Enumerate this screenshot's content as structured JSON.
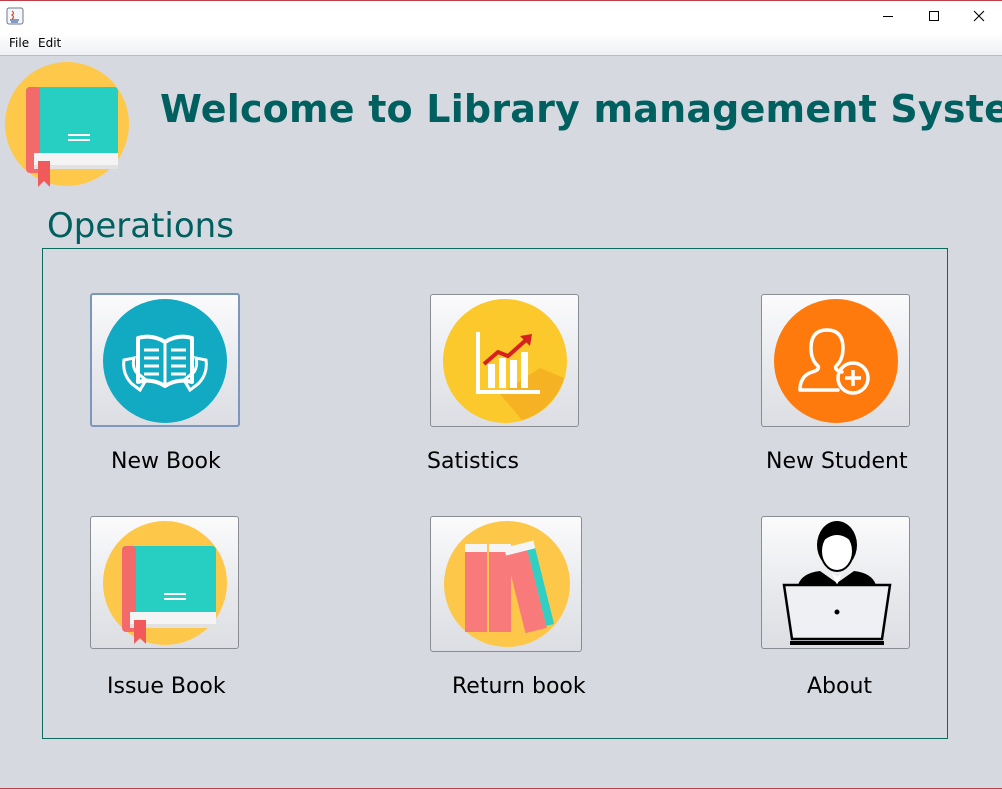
{
  "window": {
    "controls": [
      "minimize",
      "maximize",
      "close"
    ]
  },
  "menubar": {
    "items": [
      {
        "label": "File"
      },
      {
        "label": "Edit"
      }
    ]
  },
  "header": {
    "title": "Welcome to Library management System"
  },
  "operations": {
    "label": "Operations",
    "buttons": [
      {
        "label": "New Book",
        "icon": "open-book-icon",
        "color": "#12a9c2"
      },
      {
        "label": "Satistics",
        "icon": "bar-chart-icon",
        "color": "#fbc92c"
      },
      {
        "label": "New Student",
        "icon": "add-user-icon",
        "color": "#ff7a0c"
      },
      {
        "label": "Issue Book",
        "icon": "book-icon",
        "color": "#fdc74a"
      },
      {
        "label": "Return book",
        "icon": "books-icon",
        "color": "#fdc74a"
      },
      {
        "label": "About",
        "icon": "person-laptop-icon",
        "color": "#000000"
      }
    ]
  }
}
